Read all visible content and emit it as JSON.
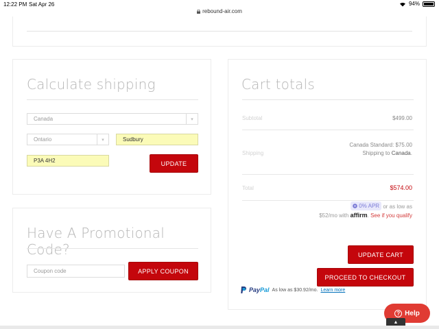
{
  "status_bar": {
    "time": "12:22 PM",
    "date": "Sat Apr 26",
    "url": "rebound-air.com",
    "battery": "94%"
  },
  "shipping": {
    "title": "Calculate shipping",
    "country": "Canada",
    "province": "Ontario",
    "city": "Sudbury",
    "postcode": "P3A 4H2",
    "update_label": "UPDATE"
  },
  "promo": {
    "title": "Have A Promotional Code?",
    "coupon_placeholder": "Coupon code",
    "apply_label": "APPLY COUPON"
  },
  "totals": {
    "title": "Cart totals",
    "subtotal_label": "Subtotal",
    "subtotal_value": "$499.00",
    "shipping_label": "Shipping",
    "shipping_method": "Canada Standard: $75.00",
    "shipping_to": "Shipping to",
    "shipping_country": "Canada",
    "total_label": "Total",
    "total_value": "$574.00",
    "affirm_apr": "0% APR",
    "affirm_as_low": "or as low as",
    "affirm_monthly": "$52/mo with",
    "affirm_brand": "affirm",
    "affirm_see": "See if you qualify",
    "update_cart_label": "UPDATE CART",
    "checkout_label": "PROCEED TO CHECKOUT",
    "paypal_text": "As low as $30.92/mo.",
    "paypal_learn": "Learn more"
  },
  "help": {
    "label": "Help"
  },
  "colors": {
    "accent": "#c4060c",
    "autofill": "#fbfbb8",
    "help": "#e03b33"
  }
}
